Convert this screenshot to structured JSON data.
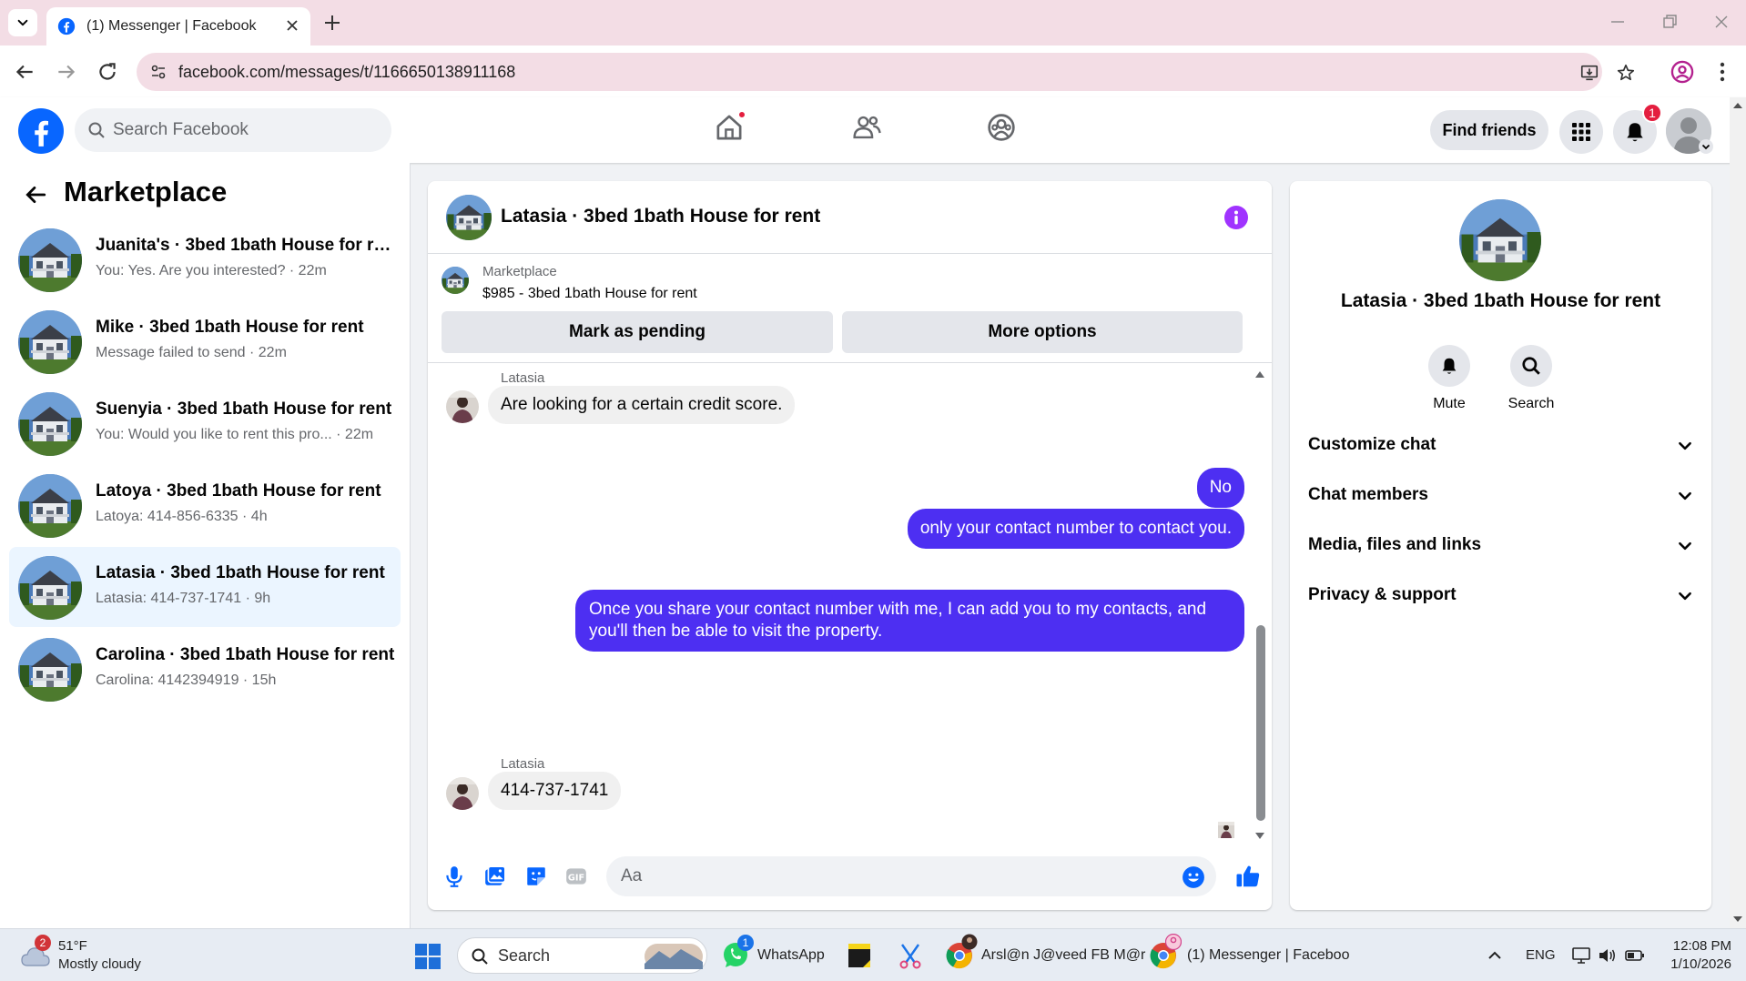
{
  "browser": {
    "tab_title": "(1) Messenger | Facebook",
    "url": "facebook.com/messages/t/1166650138911168"
  },
  "fb_header": {
    "search_placeholder": "Search Facebook",
    "find_friends_label": "Find friends",
    "notification_count": "1"
  },
  "sidebar": {
    "title": "Marketplace",
    "conversations": [
      {
        "name": "Juanita's · 3bed 1bath House for rent",
        "preview": "You: Yes. Are you interested? · 22m"
      },
      {
        "name": "Mike · 3bed 1bath House for rent",
        "preview": "Message failed to send · 22m"
      },
      {
        "name": "Suenyia · 3bed 1bath House for rent",
        "preview": "You: Would you like to rent this pro... · 22m"
      },
      {
        "name": "Latoya · 3bed 1bath House for rent",
        "preview": "Latoya: 414-856-6335 · 4h"
      },
      {
        "name": "Latasia · 3bed 1bath House for rent",
        "preview": "Latasia: 414-737-1741 · 9h"
      },
      {
        "name": "Carolina · 3bed 1bath House for rent",
        "preview": "Carolina: 4142394919 · 15h"
      }
    ]
  },
  "chat": {
    "title": "Latasia · 3bed 1bath House for rent",
    "marketplace_label": "Marketplace",
    "listing": "$985 - 3bed 1bath House for rent",
    "mark_pending_label": "Mark as pending",
    "more_options_label": "More options",
    "messages": [
      {
        "sender": "Latasia",
        "text": "Are looking for a certain credit score."
      },
      {
        "text": "No"
      },
      {
        "text": "only your contact number to contact you."
      },
      {
        "text": "Once you share your contact number with me, I can add you to my contacts, and you'll then be able to visit the property."
      },
      {
        "sender": "Latasia",
        "text": "414-737-1741"
      }
    ],
    "composer_placeholder": "Aa"
  },
  "right_panel": {
    "title": "Latasia · 3bed 1bath House for rent",
    "mute_label": "Mute",
    "search_label": "Search",
    "sections": [
      "Customize chat",
      "Chat members",
      "Media, files and links",
      "Privacy & support"
    ]
  },
  "taskbar": {
    "weather_badge": "2",
    "temperature": "51°F",
    "weather_desc": "Mostly cloudy",
    "search_label": "Search",
    "whatsapp_label": "WhatsApp",
    "whatsapp_badge": "1",
    "chrome1_label": "Arsl@n J@veed FB M@r",
    "chrome2_label": "(1) Messenger | Faceboo",
    "language": "ENG",
    "time": "12:08 PM",
    "date": "1/10/2026"
  },
  "colors": {
    "facebook_blue": "#0866ff",
    "outgoing_bubble": "#4d2ff2",
    "messenger_purple": "#a033ff",
    "chrome_tint": "#f3dde5",
    "active_row": "#ebf5ff"
  }
}
